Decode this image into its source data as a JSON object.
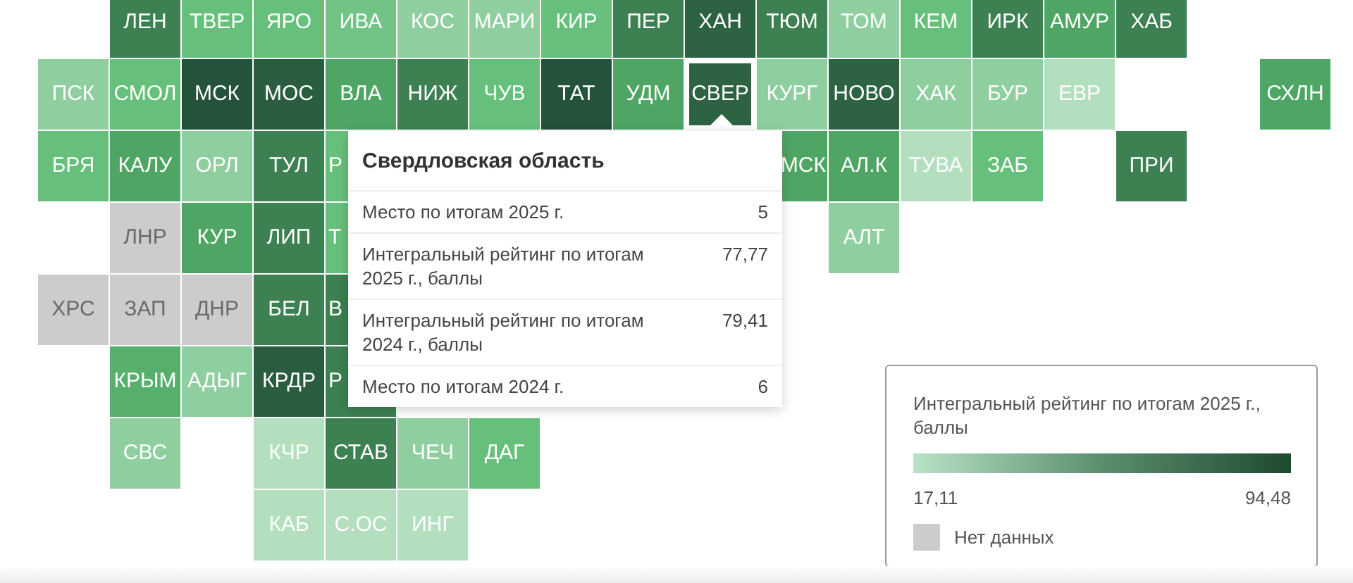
{
  "map": {
    "rows": [
      [
        {
          "kind": "gap"
        },
        {
          "kind": "region",
          "label": "ЛЕН",
          "color": "#3d8052",
          "selected": false
        },
        {
          "kind": "region",
          "label": "ТВЕР",
          "color": "#66c07b",
          "selected": false
        },
        {
          "kind": "region",
          "label": "ЯРО",
          "color": "#66c07b",
          "selected": false
        },
        {
          "kind": "region",
          "label": "ИВА",
          "color": "#72c486",
          "selected": false
        },
        {
          "kind": "region",
          "label": "КОС",
          "color": "#8fcf9f",
          "selected": false
        },
        {
          "kind": "region",
          "label": "МАРИ",
          "color": "#8fcf9f",
          "selected": false
        },
        {
          "kind": "region",
          "label": "КИР",
          "color": "#66c07b",
          "selected": false
        },
        {
          "kind": "region",
          "label": "ПЕР",
          "color": "#3d8052",
          "selected": false
        },
        {
          "kind": "region",
          "label": "ХАН",
          "color": "#2d6342",
          "selected": false
        },
        {
          "kind": "region",
          "label": "ТЮМ",
          "color": "#3d8052",
          "selected": false
        },
        {
          "kind": "region",
          "label": "ТОМ",
          "color": "#8fcf9f",
          "selected": false
        },
        {
          "kind": "region",
          "label": "КЕМ",
          "color": "#66c07b",
          "selected": false
        },
        {
          "kind": "region",
          "label": "ИРК",
          "color": "#3d8052",
          "selected": false
        },
        {
          "kind": "region",
          "label": "АМУР",
          "color": "#4fa564",
          "selected": false
        },
        {
          "kind": "region",
          "label": "ХАБ",
          "color": "#3d8052",
          "selected": false
        }
      ],
      [
        {
          "kind": "region",
          "label": "ПСК",
          "color": "#8fcf9f",
          "selected": false
        },
        {
          "kind": "region",
          "label": "СМОЛ",
          "color": "#66c07b",
          "selected": false
        },
        {
          "kind": "region",
          "label": "МСК",
          "color": "#24523a",
          "selected": false
        },
        {
          "kind": "region",
          "label": "МОС",
          "color": "#2a5c3f",
          "selected": false
        },
        {
          "kind": "region",
          "label": "ВЛА",
          "color": "#4fa564",
          "selected": false
        },
        {
          "kind": "region",
          "label": "НИЖ",
          "color": "#3d8052",
          "selected": false
        },
        {
          "kind": "region",
          "label": "ЧУВ",
          "color": "#66c07b",
          "selected": false
        },
        {
          "kind": "region",
          "label": "ТАТ",
          "color": "#24523a",
          "selected": false
        },
        {
          "kind": "region",
          "label": "УДМ",
          "color": "#4fa564",
          "selected": false
        },
        {
          "kind": "region",
          "label": "СВЕР",
          "color": "#2d6342",
          "selected": true
        },
        {
          "kind": "region",
          "label": "КУРГ",
          "color": "#8fcf9f",
          "selected": false
        },
        {
          "kind": "region",
          "label": "НОВО",
          "color": "#2d6342",
          "selected": false
        },
        {
          "kind": "region",
          "label": "ХАК",
          "color": "#8fcf9f",
          "selected": false
        },
        {
          "kind": "region",
          "label": "БУР",
          "color": "#8fcf9f",
          "selected": false
        },
        {
          "kind": "region",
          "label": "ЕВР",
          "color": "#b3dfbf",
          "selected": false
        },
        {
          "kind": "gap"
        },
        {
          "kind": "gap"
        },
        {
          "kind": "region",
          "label": "СХЛН",
          "color": "#4fa564",
          "selected": false
        }
      ],
      [
        {
          "kind": "region",
          "label": "БРЯ",
          "color": "#66c07b",
          "selected": false
        },
        {
          "kind": "region",
          "label": "КАЛУ",
          "color": "#4fa564",
          "selected": false
        },
        {
          "kind": "region",
          "label": "ОРЛ",
          "color": "#8fcf9f",
          "selected": false
        },
        {
          "kind": "region",
          "label": "ТУЛ",
          "color": "#3d8052",
          "selected": false
        },
        {
          "kind": "partial",
          "label": "Р",
          "color": "#66c07b",
          "selected": false
        },
        {
          "kind": "gap"
        },
        {
          "kind": "gap"
        },
        {
          "kind": "gap"
        },
        {
          "kind": "gap"
        },
        {
          "kind": "gap"
        },
        {
          "kind": "partial",
          "label": "МСК",
          "color": "#4fa564",
          "selected": false
        },
        {
          "kind": "region",
          "label": "АЛ.К",
          "color": "#4fa564",
          "selected": false
        },
        {
          "kind": "region",
          "label": "ТУВА",
          "color": "#b3dfbf",
          "selected": false
        },
        {
          "kind": "region",
          "label": "ЗАБ",
          "color": "#66c07b",
          "selected": false
        },
        {
          "kind": "gap"
        },
        {
          "kind": "region",
          "label": "ПРИ",
          "color": "#3d8052",
          "selected": false
        }
      ],
      [
        {
          "kind": "gap"
        },
        {
          "kind": "region",
          "label": "ЛНР",
          "color": "#cccccc",
          "selected": false
        },
        {
          "kind": "region",
          "label": "КУР",
          "color": "#4fa564",
          "selected": false
        },
        {
          "kind": "region",
          "label": "ЛИП",
          "color": "#3d8052",
          "selected": false
        },
        {
          "kind": "partial",
          "label": "Т",
          "color": "#66c07b",
          "selected": false
        },
        {
          "kind": "gap"
        },
        {
          "kind": "gap"
        },
        {
          "kind": "gap"
        },
        {
          "kind": "gap"
        },
        {
          "kind": "gap"
        },
        {
          "kind": "gap"
        },
        {
          "kind": "region",
          "label": "АЛТ",
          "color": "#8fcf9f",
          "selected": false
        }
      ],
      [
        {
          "kind": "region",
          "label": "ХРС",
          "color": "#cccccc",
          "selected": false
        },
        {
          "kind": "region",
          "label": "ЗАП",
          "color": "#cccccc",
          "selected": false
        },
        {
          "kind": "region",
          "label": "ДНР",
          "color": "#cccccc",
          "selected": false
        },
        {
          "kind": "region",
          "label": "БЕЛ",
          "color": "#3d8052",
          "selected": false
        },
        {
          "kind": "partial",
          "label": "В",
          "color": "#3d8052",
          "selected": false
        }
      ],
      [
        {
          "kind": "gap"
        },
        {
          "kind": "region",
          "label": "КРЫМ",
          "color": "#56b06b",
          "selected": false
        },
        {
          "kind": "region",
          "label": "АДЫГ",
          "color": "#8fcf9f",
          "selected": false
        },
        {
          "kind": "region",
          "label": "КРДР",
          "color": "#2a5c3f",
          "selected": false
        },
        {
          "kind": "partial",
          "label": "Р",
          "color": "#3d8052",
          "selected": false
        }
      ],
      [
        {
          "kind": "gap"
        },
        {
          "kind": "region",
          "label": "СВС",
          "color": "#8fcf9f",
          "selected": false
        },
        {
          "kind": "gap"
        },
        {
          "kind": "region",
          "label": "КЧР",
          "color": "#b3dfbf",
          "selected": false
        },
        {
          "kind": "region",
          "label": "СТАВ",
          "color": "#3d8052",
          "selected": false
        },
        {
          "kind": "region",
          "label": "ЧЕЧ",
          "color": "#8fcf9f",
          "selected": false
        },
        {
          "kind": "region",
          "label": "ДАГ",
          "color": "#66c07b",
          "selected": false
        }
      ],
      [
        {
          "kind": "gap"
        },
        {
          "kind": "gap"
        },
        {
          "kind": "gap"
        },
        {
          "kind": "region",
          "label": "КАБ",
          "color": "#b3dfbf",
          "selected": false
        },
        {
          "kind": "region",
          "label": "С.ОС",
          "color": "#b3dfbf",
          "selected": false
        },
        {
          "kind": "region",
          "label": "ИНГ",
          "color": "#b3dfbf",
          "selected": false
        }
      ]
    ]
  },
  "tooltip": {
    "title": "Свердловская область",
    "rows": [
      {
        "label": "Место по итогам 2025 г.",
        "value": "5"
      },
      {
        "label": "Интегральный рейтинг по итогам 2025 г., баллы",
        "value": "77,77"
      },
      {
        "label": "Интегральный рейтинг по итогам 2024 г., баллы",
        "value": "79,41"
      },
      {
        "label": "Место по итогам 2024 г.",
        "value": "6"
      }
    ]
  },
  "legend": {
    "title": "Интегральный рейтинг по итогам 2025 г., баллы",
    "min": "17,11",
    "max": "94,48",
    "no_data": {
      "label": "Нет данных",
      "color": "#cccccc"
    }
  }
}
